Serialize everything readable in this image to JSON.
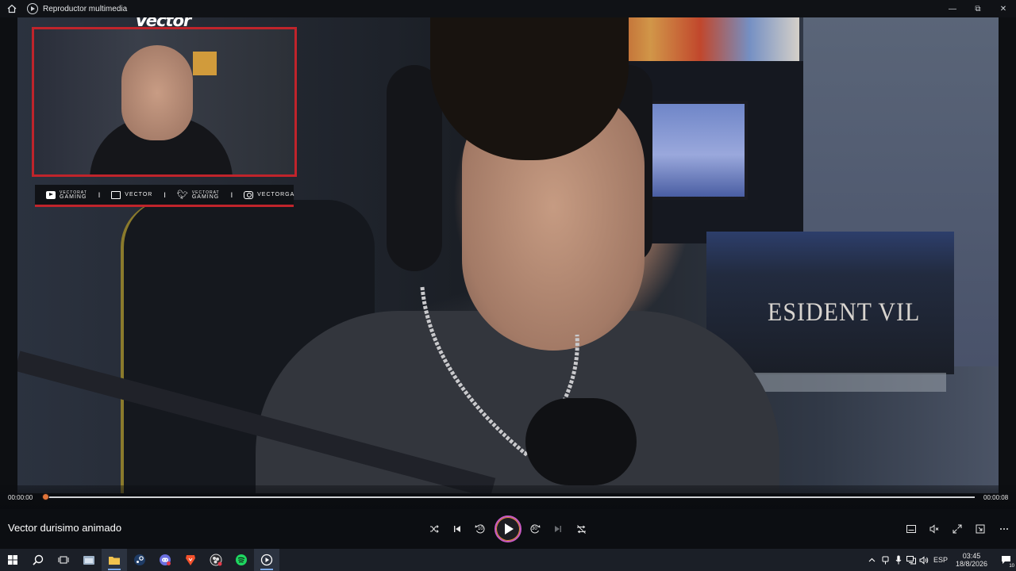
{
  "window": {
    "title": "Reproductor multimedia",
    "minimize": "—",
    "restore": "⧉",
    "close": "✕"
  },
  "overlay": {
    "streamer_logo": "Vector",
    "socials": [
      {
        "icon": "youtube-icon",
        "line1": "VECTORAT",
        "line2": "GAMING"
      },
      {
        "icon": "twitch-icon",
        "line1": "VECTOR",
        "line2": ""
      },
      {
        "icon": "twitter-icon",
        "line1": "VECTORAT",
        "line2": "GAMING"
      },
      {
        "icon": "instagram-icon",
        "line1": "VECTORGA",
        "line2": ""
      }
    ],
    "separator": "I",
    "background_sign": "ESIDENT VIL"
  },
  "player": {
    "elapsed": "00:00:00",
    "duration": "00:00:08",
    "progress": 0.0,
    "media_title": "Vector durisimo animado",
    "skip_back_seconds": "10",
    "skip_forward_seconds": "30"
  },
  "colors": {
    "accent_overlay": "#c0242b",
    "scrub_thumb": "#e2743a",
    "play_ring": "#c75ac4"
  },
  "taskbar": {
    "apps": [
      "start-icon",
      "search-icon",
      "task-view-icon",
      "file-explorer-icon",
      "folder-icon",
      "steam-icon",
      "discord-icon",
      "brave-icon",
      "obs-icon",
      "spotify-icon",
      "media-player-icon"
    ],
    "language": "ESP",
    "time": "03:45",
    "date": "18/8/2026",
    "notifications": "10"
  }
}
